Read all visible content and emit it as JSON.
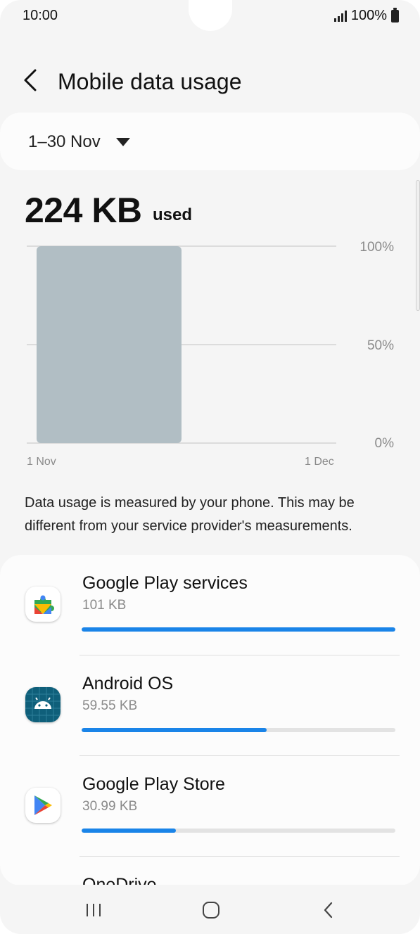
{
  "status_bar": {
    "time": "10:00",
    "battery_text": "100%",
    "signal_icon": "signal-icon",
    "battery_icon": "battery-icon"
  },
  "header": {
    "title": "Mobile data usage",
    "back_icon": "back-arrow-icon"
  },
  "period": {
    "label": "1–30 Nov",
    "dropdown_icon": "caret-down-icon"
  },
  "usage": {
    "amount": "224 KB",
    "unit_label": "used"
  },
  "chart_data": {
    "type": "bar",
    "categories": [
      "1 Nov"
    ],
    "values": [
      100
    ],
    "y_ticks": [
      "100%",
      "50%",
      "0%"
    ],
    "x_ticks": [
      "1 Nov",
      "1 Dec"
    ],
    "ylim": [
      0,
      100
    ],
    "bar_color": "#b1bec4",
    "grid": true,
    "title": "",
    "xlabel": "",
    "ylabel": ""
  },
  "disclaimer": "Data usage is measured by your phone. This may be different from your service provider's measurements.",
  "apps": [
    {
      "name": "Google Play services",
      "size": "101 KB",
      "fraction": 1.0,
      "icon": "google-play-services-icon"
    },
    {
      "name": "Android OS",
      "size": "59.55 KB",
      "fraction": 0.59,
      "icon": "android-os-icon"
    },
    {
      "name": "Google Play Store",
      "size": "30.99 KB",
      "fraction": 0.3,
      "icon": "google-play-store-icon"
    },
    {
      "name": "OneDrive",
      "size": "",
      "fraction": 0,
      "icon": "onedrive-icon"
    }
  ],
  "nav": {
    "recents_icon": "recents-icon",
    "home_icon": "home-icon",
    "back_icon": "nav-back-icon"
  },
  "colors": {
    "accent": "#1a84e8",
    "track": "#e3e3e3",
    "background": "#f5f5f5",
    "card": "#fcfcfc"
  }
}
